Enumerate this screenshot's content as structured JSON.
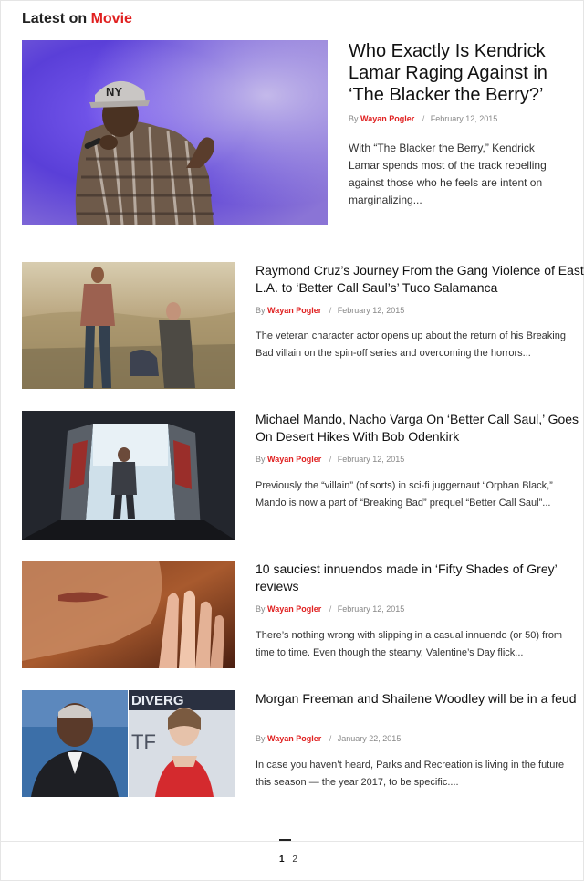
{
  "section": {
    "prefix": "Latest on ",
    "category": "Movie"
  },
  "featured": {
    "title": "Who Exactly Is Kendrick Lamar Raging Against in ‘The Blacker the Berry?’",
    "by": "By",
    "author": "Wayan Pogler",
    "sep": "/",
    "date": "February 12, 2015",
    "excerpt": "With “The Blacker the Berry,” Kendrick Lamar spends most of the track rebelling against those who he feels are intent on marginalizing..."
  },
  "articles": [
    {
      "title": "Raymond Cruz’s Journey From the Gang Violence of East L.A. to ‘Better Call Saul’s’ Tuco Salamanca",
      "by": "By",
      "author": "Wayan Pogler",
      "sep": "/",
      "date": "February 12, 2015",
      "excerpt": "The veteran character actor opens up about the return of his Breaking Bad villain on the spin-off series and overcoming the horrors..."
    },
    {
      "title": "Michael Mando, Nacho Varga On ‘Better Call Saul,’ Goes On Desert Hikes With Bob Odenkirk",
      "by": "By",
      "author": "Wayan Pogler",
      "sep": "/",
      "date": "February 12, 2015",
      "excerpt": "Previously the “villain” (of sorts) in sci-fi juggernaut “Orphan Black,” Mando is now a part of “Breaking Bad” prequel “Better Call Saul”..."
    },
    {
      "title": "10 sauciest innuendos made in ‘Fifty Shades of Grey’ reviews",
      "by": "By",
      "author": "Wayan Pogler",
      "sep": "/",
      "date": "February 12, 2015",
      "excerpt": "There’s nothing wrong with slipping in a casual innuendo (or 50) from time to time. Even though the steamy, Valentine’s Day flick..."
    },
    {
      "title": "Morgan Freeman and Shailene Woodley will be in a feud",
      "by": "By",
      "author": "Wayan Pogler",
      "sep": "/",
      "date": "January 22, 2015",
      "excerpt": "In case you haven’t heard, Parks and Recreation is living in the future this season — the year 2017, to be specific...."
    }
  ],
  "pagination": {
    "current": "1",
    "next": "2"
  },
  "image_text": {
    "cap_letters": "NY",
    "backdrop_text": "DIVERG",
    "backdrop_text_2": "TF"
  },
  "colors": {
    "accent": "#e02020",
    "text": "#111111",
    "meta": "#888888"
  }
}
